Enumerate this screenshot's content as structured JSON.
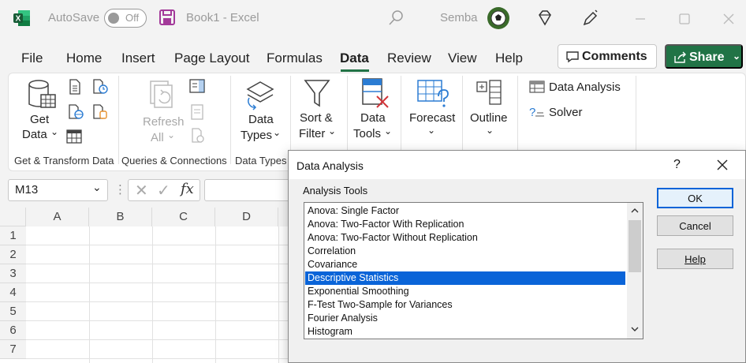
{
  "titlebar": {
    "autosave_label": "AutoSave",
    "autosave_state": "Off",
    "document_title": "Book1  -  Excel",
    "user_name": "Semba"
  },
  "menu": {
    "tabs": [
      "File",
      "Home",
      "Insert",
      "Page Layout",
      "Formulas",
      "Data",
      "Review",
      "View",
      "Help"
    ],
    "active_tab": "Data",
    "comments_label": "Comments",
    "share_label": "Share"
  },
  "ribbon": {
    "get_data_line1": "Get",
    "get_data_line2": "Data",
    "refresh_line1": "Refresh",
    "refresh_line2": "All",
    "data_types_line1": "Data",
    "data_types_line2": "Types",
    "sort_filter_line1": "Sort &",
    "sort_filter_line2": "Filter",
    "data_tools_line1": "Data",
    "data_tools_line2": "Tools",
    "forecast_label": "Forecast",
    "outline_label": "Outline",
    "data_analysis_label": "Data Analysis",
    "solver_label": "Solver",
    "groups": {
      "get_transform": "Get & Transform Data",
      "queries": "Queries & Connections",
      "data_types": "Data Types"
    }
  },
  "formula_bar": {
    "name_box": "M13",
    "fx_symbol": "fx"
  },
  "grid": {
    "columns": [
      "A",
      "B",
      "C",
      "D"
    ],
    "rows": [
      "1",
      "2",
      "3",
      "4",
      "5",
      "6",
      "7"
    ]
  },
  "dialog": {
    "title": "Data Analysis",
    "help_symbol": "?",
    "tools_label": "Analysis Tools",
    "tools": [
      "Anova: Single Factor",
      "Anova: Two-Factor With Replication",
      "Anova: Two-Factor Without Replication",
      "Correlation",
      "Covariance",
      "Descriptive Statistics",
      "Exponential Smoothing",
      "F-Test Two-Sample for Variances",
      "Fourier Analysis",
      "Histogram"
    ],
    "selected_tool": "Descriptive Statistics",
    "ok_label": "OK",
    "cancel_label": "Cancel",
    "help_label": "Help"
  },
  "colors": {
    "accent_green": "#217346",
    "selection_blue": "#0a64d8"
  }
}
